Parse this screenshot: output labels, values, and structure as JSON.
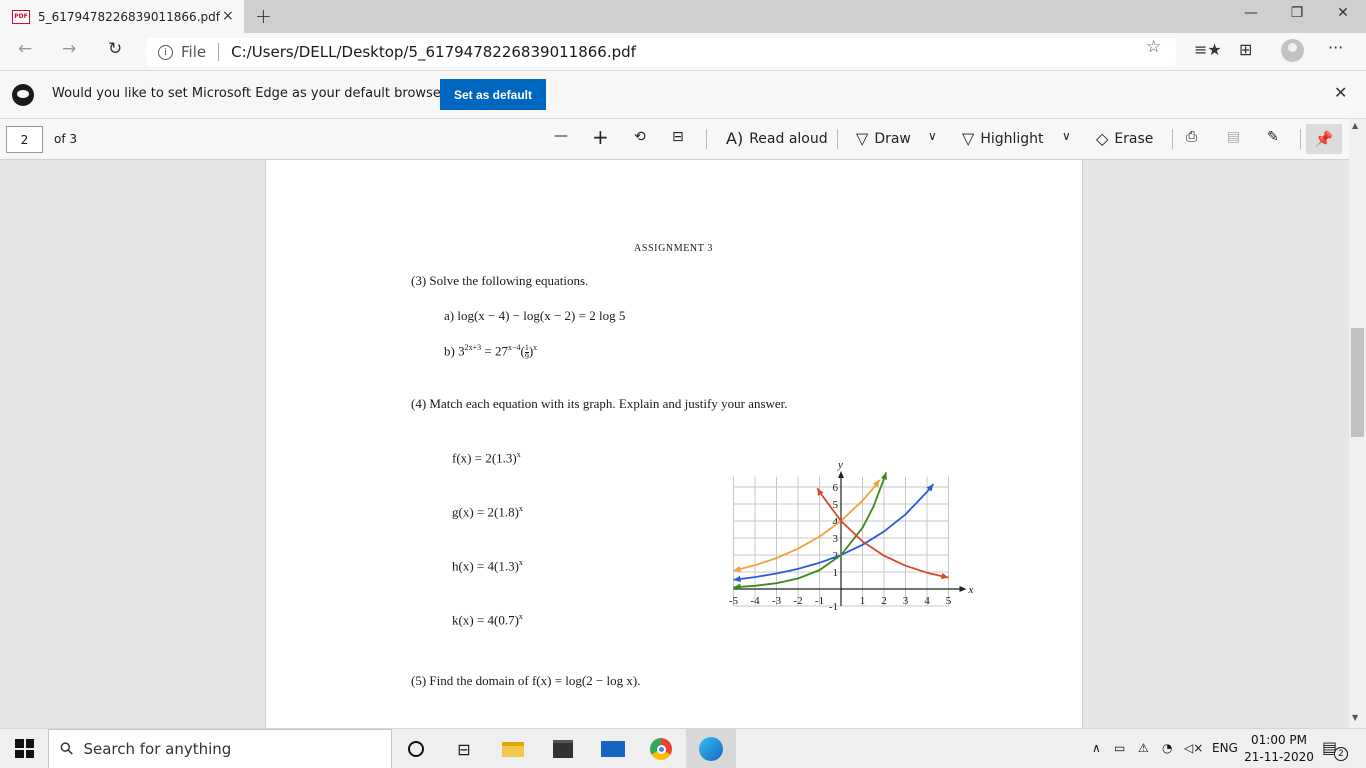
{
  "tab": {
    "favicon_text": "PDF",
    "title": "5_6179478226839011866.pdf",
    "close": "×",
    "new_tab": "+"
  },
  "window": {
    "minimize": "—",
    "restore": "❐",
    "close": "✕"
  },
  "address": {
    "back": "←",
    "forward": "→",
    "refresh": "↻",
    "info": "i",
    "scheme": "File",
    "url": "C:/Users/DELL/Desktop/5_6179478226839011866.pdf",
    "more": "···"
  },
  "infobar": {
    "message": "Would you like to set Microsoft Edge as your default browser?",
    "button": "Set as default",
    "close": "✕"
  },
  "pdf_toolbar": {
    "page_number": "2",
    "page_of": "of 3",
    "zoom_out": "—",
    "zoom_in": "+",
    "read_aloud": "Read aloud",
    "draw": "Draw",
    "highlight": "Highlight",
    "erase": "Erase"
  },
  "document": {
    "header": "ASSIGNMENT 3",
    "q3": "(3)  Solve the following equations.",
    "q3a": "a)  log(x − 4) − log(x − 2) = 2 log 5",
    "q3b_prefix": "b)  3",
    "q3b_exp1": "2x+3",
    "q3b_mid": " = 27",
    "q3b_exp2": "x−4",
    "q3b_frac_num": "1",
    "q3b_frac_den": "9",
    "q3b_exp3": "x",
    "q4": "(4)  Match each equation with its graph. Explain and justify your answer.",
    "functions": [
      {
        "name": "f(x) = 2(1.3)",
        "exp": "x"
      },
      {
        "name": "g(x) = 2(1.8)",
        "exp": "x"
      },
      {
        "name": "h(x) = 4(1.3)",
        "exp": "x"
      },
      {
        "name": "k(x) = 4(0.7)",
        "exp": "x"
      }
    ],
    "q5": "(5)  Find the domain of f(x) = log(2 − log x)."
  },
  "chart_data": {
    "type": "line",
    "xlabel": "x",
    "ylabel": "y",
    "xlim": [
      -5,
      5
    ],
    "ylim": [
      -1,
      6
    ],
    "x_ticks": [
      "-5",
      "-4",
      "-3",
      "-2",
      "-1",
      "1",
      "2",
      "3",
      "4",
      "5"
    ],
    "y_ticks": [
      "-1",
      "1",
      "2",
      "3",
      "4",
      "5",
      "6"
    ],
    "grid": true,
    "series": [
      {
        "color": "#2a5bd7",
        "x": [
          -5,
          -4,
          -3,
          -2,
          -1,
          0,
          1,
          2,
          3,
          4,
          4.3
        ],
        "y": [
          0.54,
          0.7,
          0.91,
          1.18,
          1.54,
          2.0,
          2.6,
          3.38,
          4.39,
          5.71,
          6.17
        ]
      },
      {
        "color": "#3b8a1e",
        "x": [
          -5,
          -4,
          -3,
          -2,
          -1,
          0,
          1,
          1.5,
          2,
          2.1
        ],
        "y": [
          0.1,
          0.19,
          0.34,
          0.62,
          1.11,
          2.0,
          3.6,
          4.83,
          6.48,
          6.86
        ]
      },
      {
        "color": "#f0a33a",
        "x": [
          -5,
          -4,
          -3,
          -2,
          -1,
          0,
          1,
          1.5,
          1.8
        ],
        "y": [
          1.08,
          1.4,
          1.82,
          2.37,
          3.08,
          4.0,
          5.2,
          5.93,
          6.42
        ]
      },
      {
        "color": "#e0452b",
        "x": [
          -1.1,
          -1,
          0,
          1,
          2,
          3,
          4,
          5
        ],
        "y": [
          5.93,
          5.71,
          4.0,
          2.8,
          1.96,
          1.37,
          0.96,
          0.67
        ]
      }
    ]
  },
  "taskbar": {
    "search_placeholder": "Search for anything",
    "language": "ENG",
    "time": "01:00 PM",
    "date": "21-11-2020",
    "notifications": "2"
  }
}
